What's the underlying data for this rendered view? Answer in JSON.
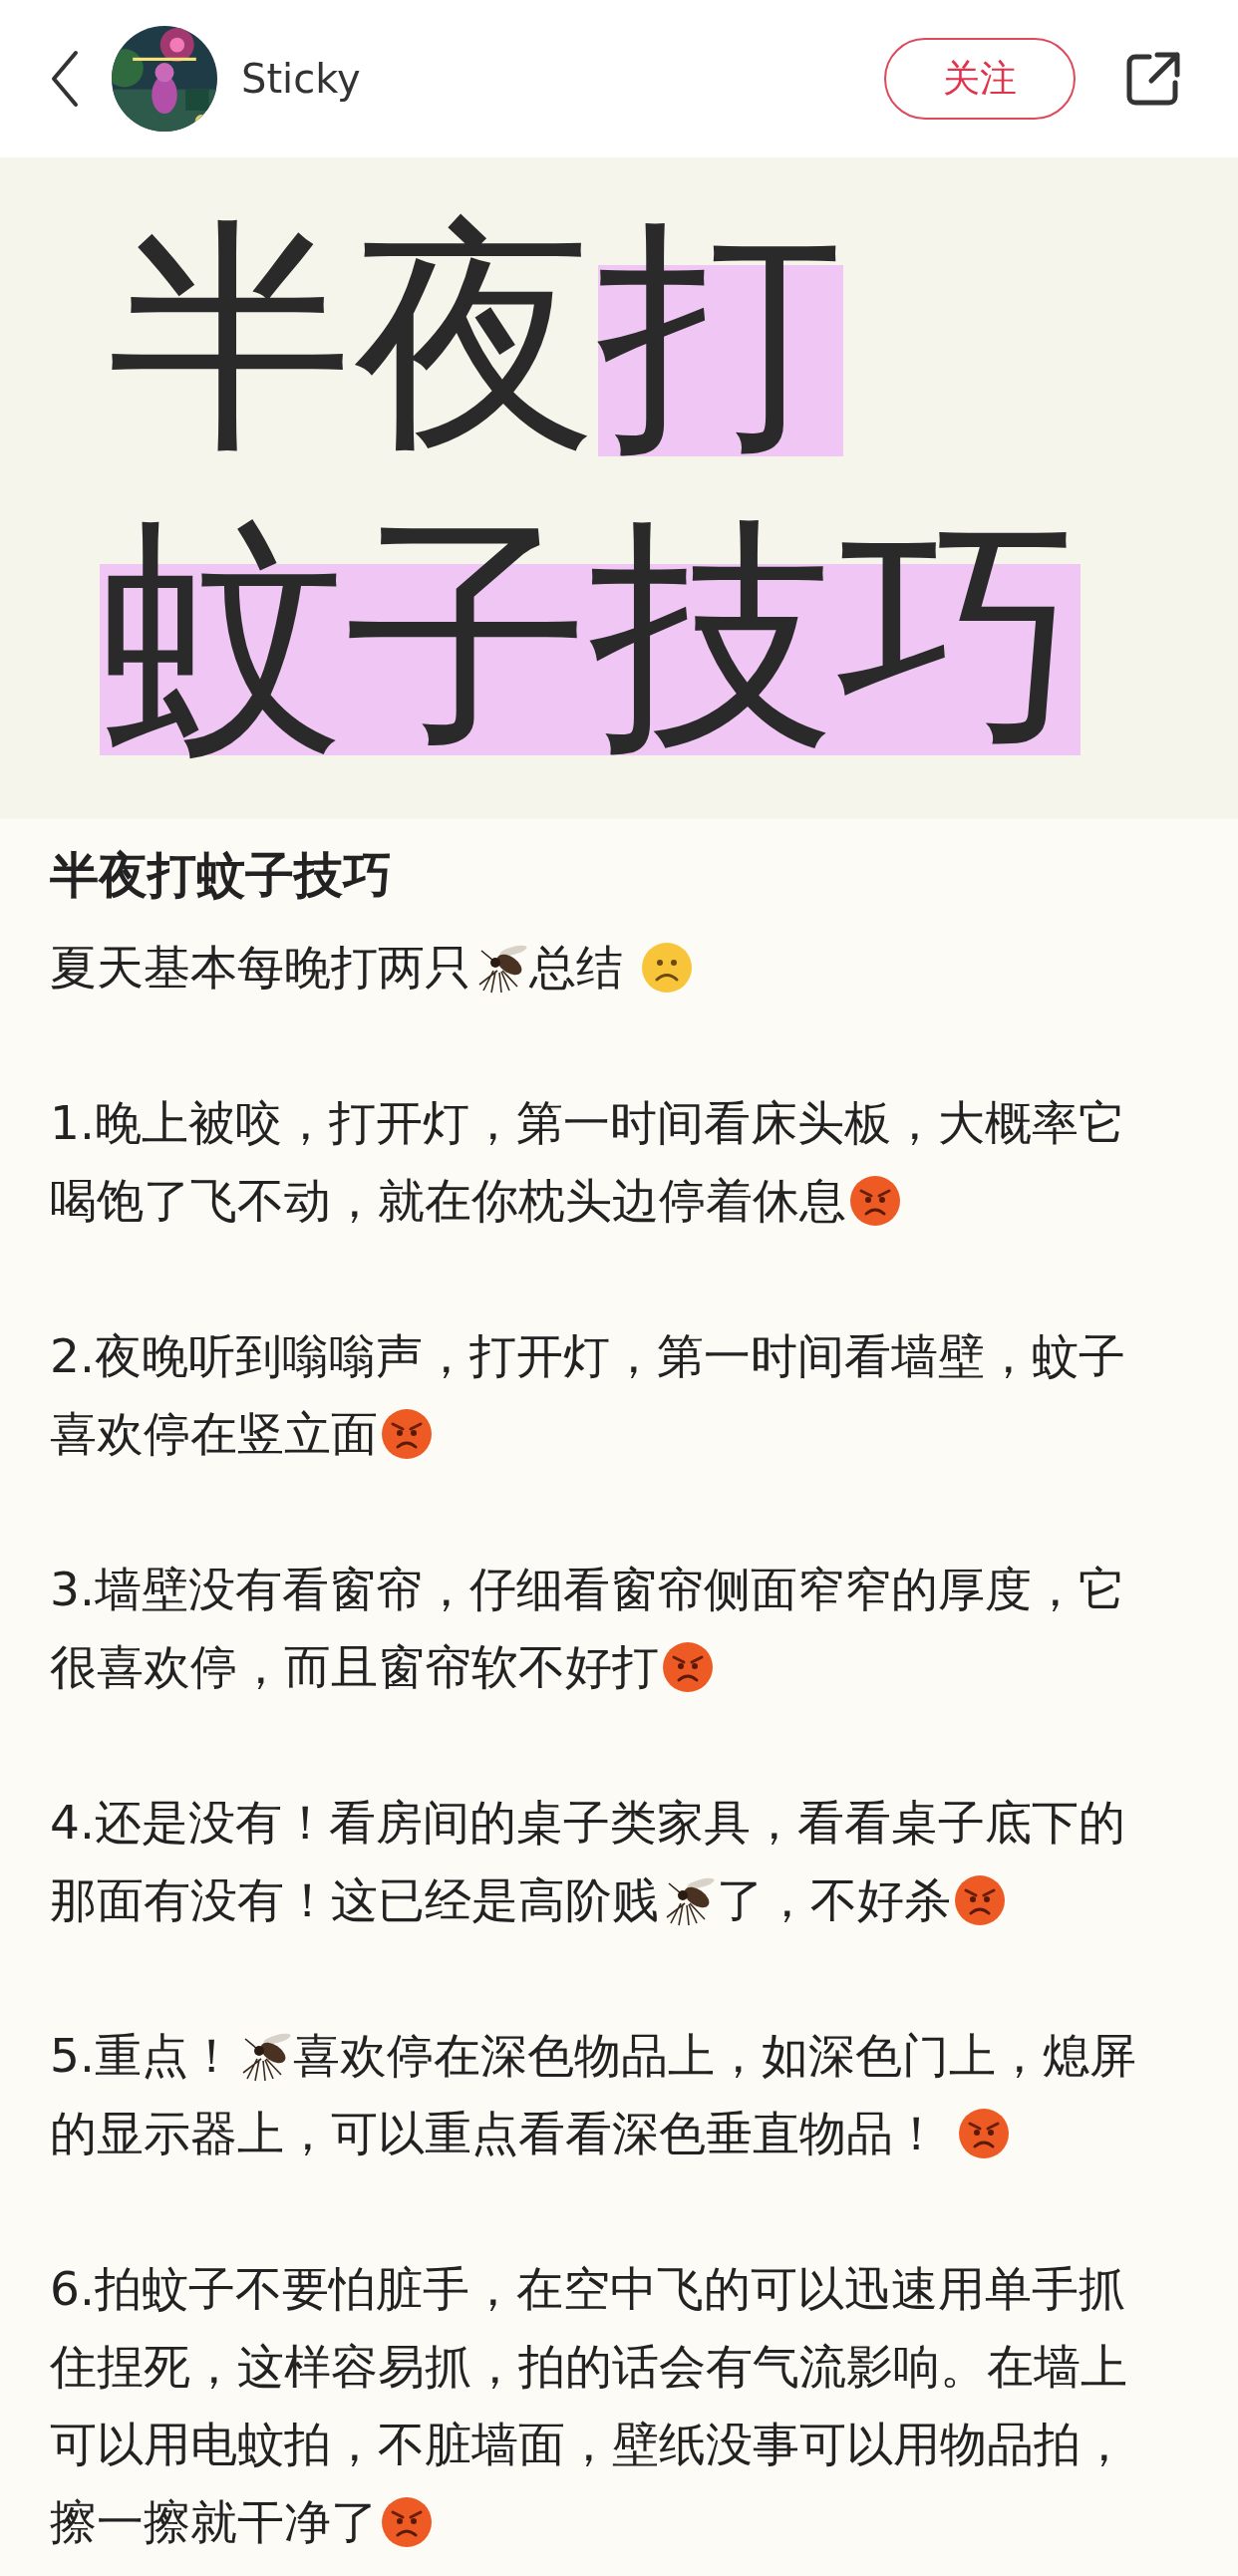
{
  "header": {
    "author": "Sticky",
    "follow_button": "关注"
  },
  "cover": {
    "lines": [
      [
        {
          "text": "半夜",
          "highlight": false
        },
        {
          "text": "打",
          "highlight": true
        }
      ],
      [
        {
          "text": "蚊子技巧",
          "highlight": true
        }
      ]
    ]
  },
  "post": {
    "title": "半夜打蚊子技巧",
    "paragraphs": [
      [
        [
          {
            "kind": "text",
            "text": "夏天基本每晚打两只"
          },
          {
            "kind": "mosquito"
          },
          {
            "kind": "text",
            "text": "总结 "
          },
          {
            "kind": "frown"
          }
        ]
      ],
      [
        [
          {
            "kind": "text",
            "text": "1.晚上被咬，打开灯，第一时间看床头板，大概率它"
          }
        ],
        [
          {
            "kind": "text",
            "text": "喝饱了飞不动，就在你枕头边停着休息"
          },
          {
            "kind": "angry"
          }
        ]
      ],
      [
        [
          {
            "kind": "text",
            "text": "2.夜晚听到嗡嗡声，打开灯，第一时间看墙壁，蚊子"
          }
        ],
        [
          {
            "kind": "text",
            "text": "喜欢停在竖立面"
          },
          {
            "kind": "angry"
          }
        ]
      ],
      [
        [
          {
            "kind": "text",
            "text": "3.墙壁没有看窗帘，仔细看窗帘侧面窄窄的厚度，它"
          }
        ],
        [
          {
            "kind": "text",
            "text": "很喜欢停，而且窗帘软不好打"
          },
          {
            "kind": "angry"
          }
        ]
      ],
      [
        [
          {
            "kind": "text",
            "text": "4.还是没有！看房间的桌子类家具，看看桌子底下的"
          }
        ],
        [
          {
            "kind": "text",
            "text": "那面有没有！这已经是高阶贱"
          },
          {
            "kind": "mosquito"
          },
          {
            "kind": "text",
            "text": "了，不好杀"
          },
          {
            "kind": "angry"
          }
        ]
      ],
      [
        [
          {
            "kind": "text",
            "text": "5.重点！"
          },
          {
            "kind": "mosquito"
          },
          {
            "kind": "text",
            "text": "喜欢停在深色物品上，如深色门上，熄屏"
          }
        ],
        [
          {
            "kind": "text",
            "text": "的显示器上，可以重点看看深色垂直物品！ "
          },
          {
            "kind": "angry"
          }
        ]
      ],
      [
        [
          {
            "kind": "text",
            "text": "6.拍蚊子不要怕脏手，在空中飞的可以迅速用单手抓"
          }
        ],
        [
          {
            "kind": "text",
            "text": "住捏死，这样容易抓，拍的话会有气流影响。在墙上"
          }
        ],
        [
          {
            "kind": "text",
            "text": "可以用电蚊拍，不脏墙面，壁纸没事可以用物品拍，"
          }
        ],
        [
          {
            "kind": "text",
            "text": "擦一擦就干净了"
          },
          {
            "kind": "angry"
          }
        ]
      ]
    ]
  }
}
